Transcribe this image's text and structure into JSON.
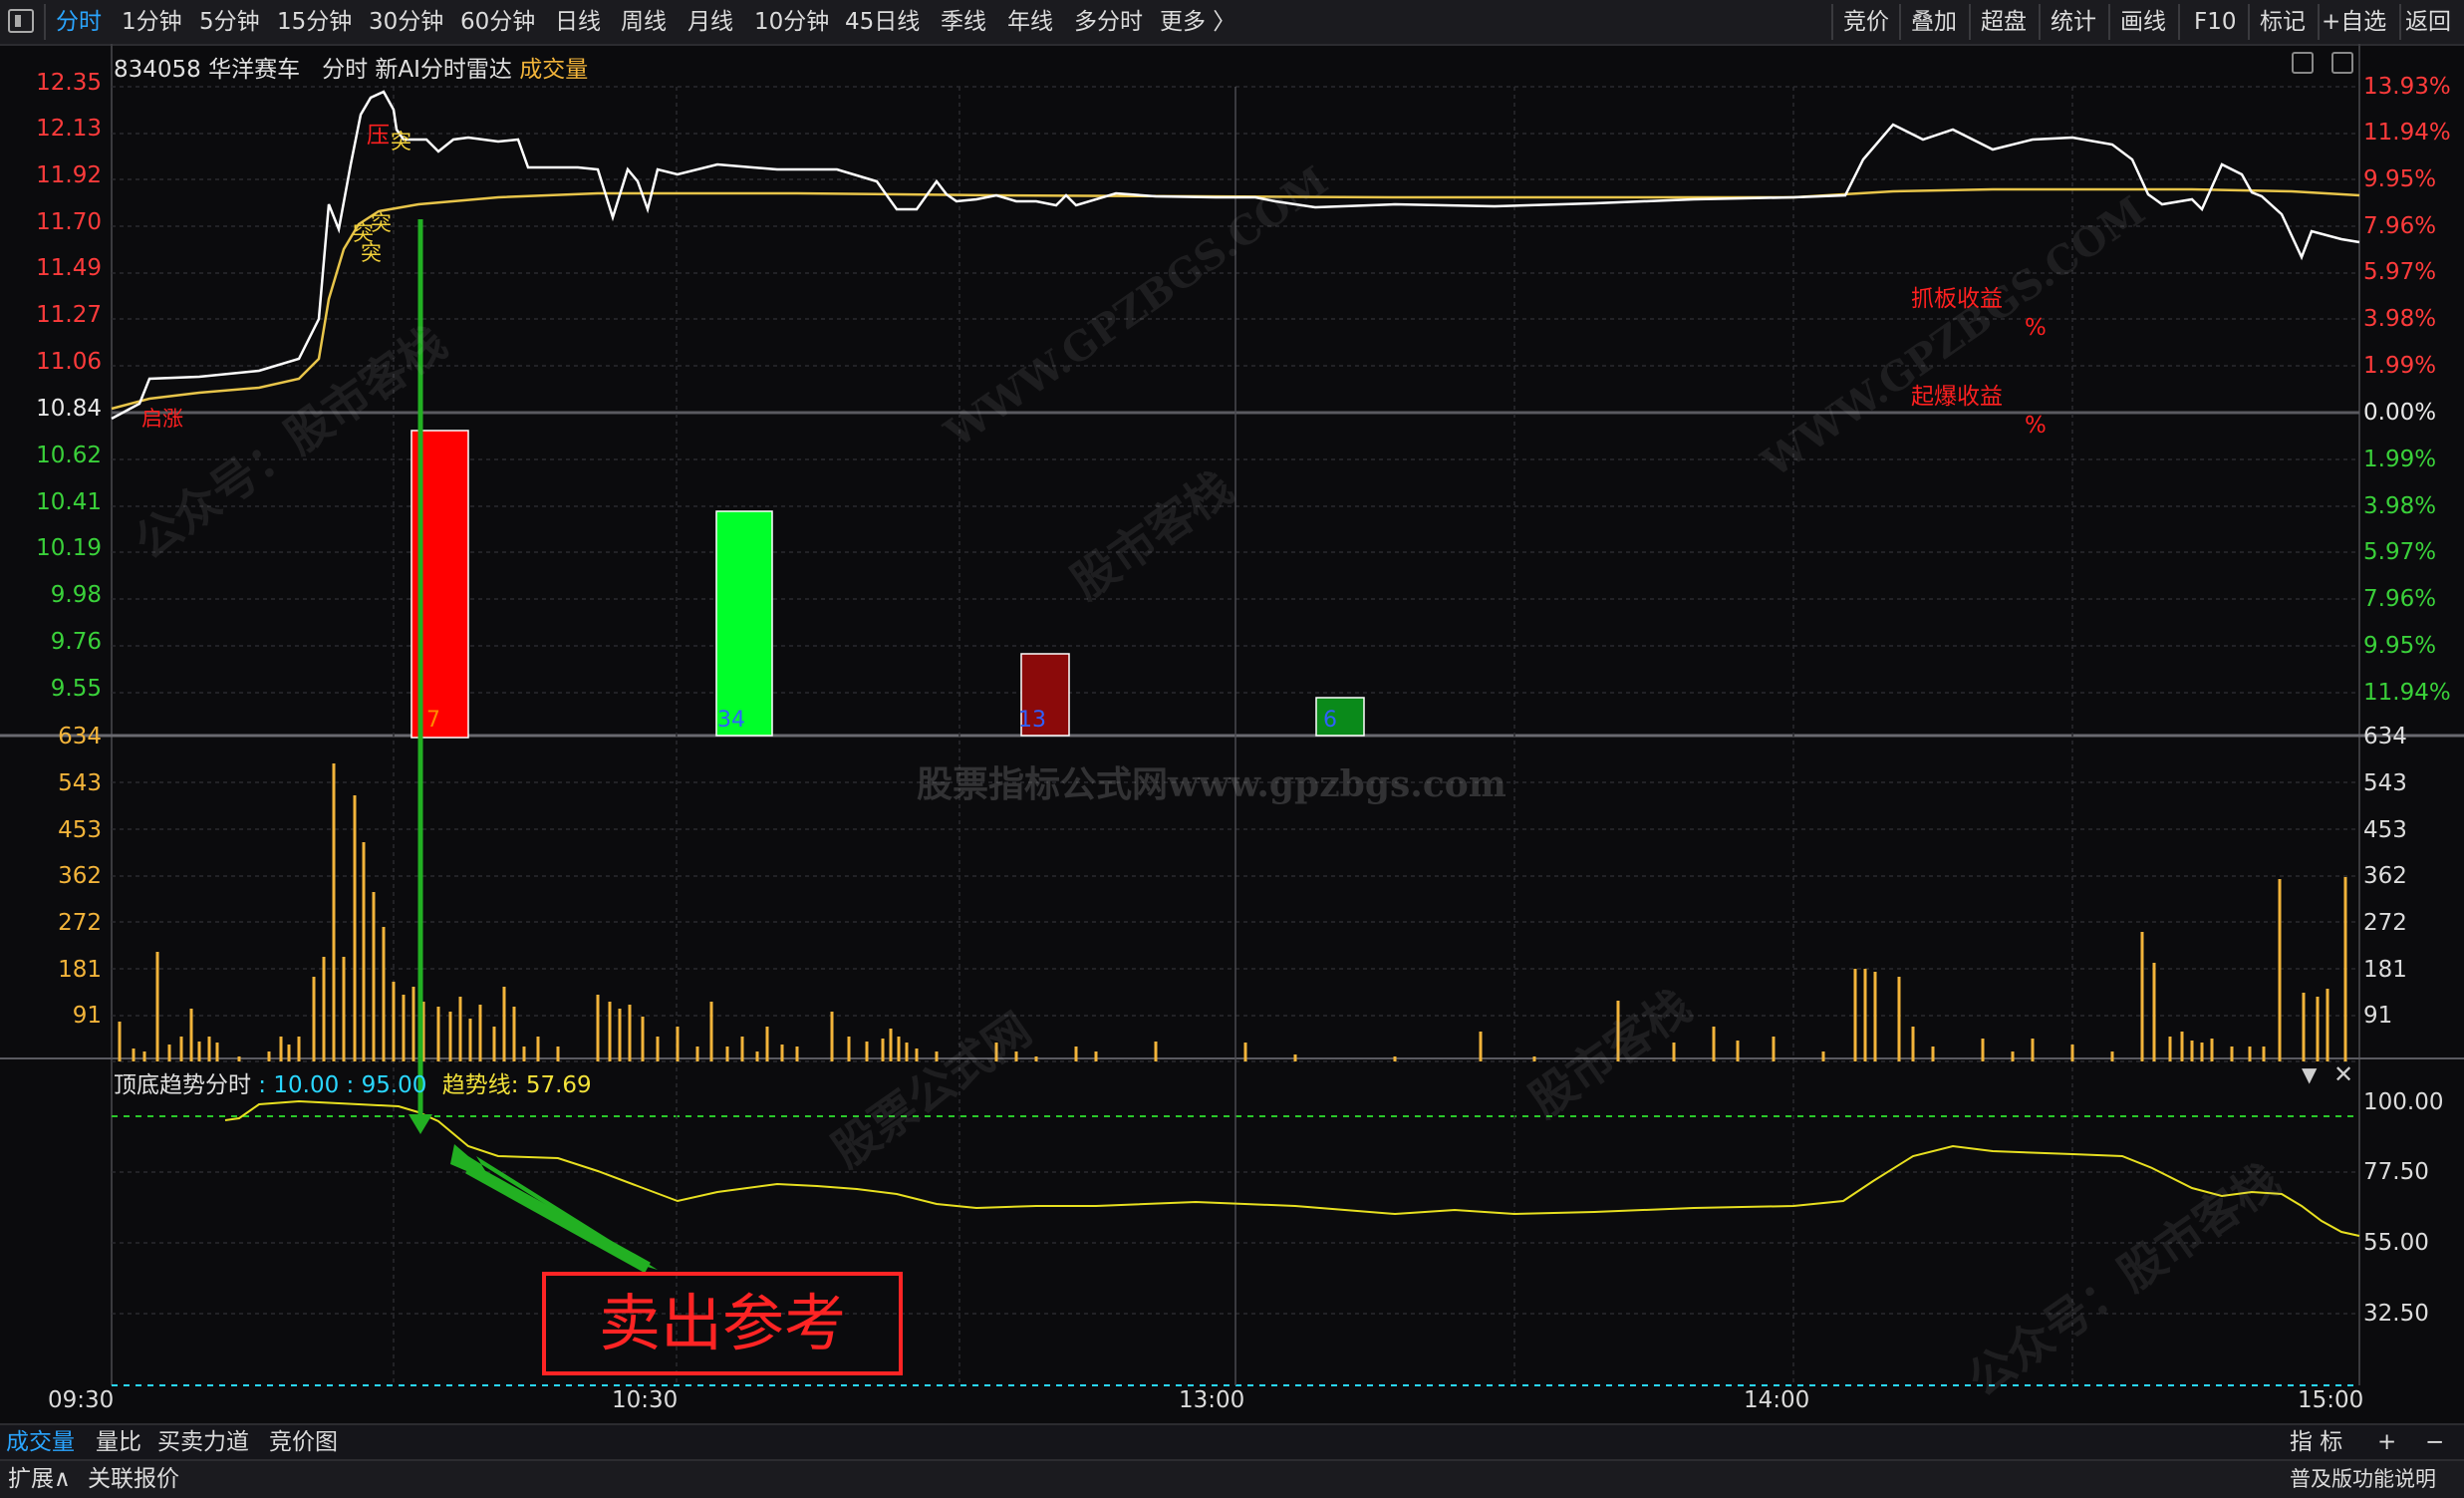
{
  "toolbar": {
    "periods": [
      "分时",
      "1分钟",
      "5分钟",
      "15分钟",
      "30分钟",
      "60分钟",
      "日线",
      "周线",
      "月线",
      "10分钟",
      "45日线",
      "季线",
      "年线",
      "多分时",
      "更多 〉"
    ],
    "active_period": "分时",
    "right_buttons": [
      "竞价",
      "叠加",
      "超盘",
      "统计",
      "画线",
      "F10",
      "标记",
      "+自选",
      "返回"
    ]
  },
  "stock": {
    "code": "834058",
    "name": "华洋赛车",
    "view": "分时",
    "indicator": "新AI分时雷达",
    "volume_label": "成交量"
  },
  "price_axis_left": [
    "12.35",
    "12.13",
    "11.92",
    "11.70",
    "11.49",
    "11.27",
    "11.06",
    "10.84",
    "10.62",
    "10.41",
    "10.19",
    "9.98",
    "9.76",
    "9.55"
  ],
  "price_axis_right": [
    "13.93%",
    "11.94%",
    "9.95%",
    "7.96%",
    "5.97%",
    "3.98%",
    "1.99%",
    "0.00%",
    "1.99%",
    "3.98%",
    "5.97%",
    "7.96%",
    "9.95%",
    "11.94%"
  ],
  "volume_axis": [
    "634",
    "543",
    "453",
    "362",
    "272",
    "181",
    "91"
  ],
  "indicator_axis": [
    "100.00",
    "77.50",
    "55.00",
    "32.50"
  ],
  "time_axis": [
    "09:30",
    "10:30",
    "13:00",
    "14:00",
    "15:00"
  ],
  "indicator_panel": {
    "name": "顶底趋势分时",
    "params": "10.00 : 95.00",
    "trend_label": "趋势线",
    "trend_value": "57.69"
  },
  "chart_annotations": {
    "press": "压",
    "breaks": [
      "突",
      "突",
      "突",
      "突"
    ],
    "start": "启涨",
    "grab_return_label": "抓板收益",
    "grab_return_unit": "%",
    "explode_return_label": "起爆收益",
    "explode_return_unit": "%",
    "sell_reference": "卖出参考"
  },
  "signal_bars": [
    {
      "label": "7",
      "color": "#ff0000"
    },
    {
      "label": "34",
      "color": "#00ff2a"
    },
    {
      "label": "13",
      "color": "#8b0a0a"
    },
    {
      "label": "6",
      "color": "#0a8a1a"
    }
  ],
  "watermarks": {
    "center": "股票指标公式网www.gpzbgs.com",
    "brand": "股市客栈",
    "account": "公众号：股市客栈",
    "site": "WWW.GPZBGS.COM",
    "site_cn": "股票公式网"
  },
  "bottom_tabs": [
    "成交量",
    "量比",
    "买卖力道",
    "竞价图"
  ],
  "bottom_tabs_active": "成交量",
  "bottom_right": [
    "指 标",
    "+",
    "−"
  ],
  "status_bar": [
    "扩展∧",
    "关联报价"
  ],
  "status_right": "普及版功能说明",
  "colors": {
    "price_up": "#ff3b3b",
    "price_down": "#3ad13a",
    "line_price": "#ffffff",
    "line_avg": "#e8c54a",
    "volume": "#f3b43a",
    "accent": "#2aa5ff"
  }
}
